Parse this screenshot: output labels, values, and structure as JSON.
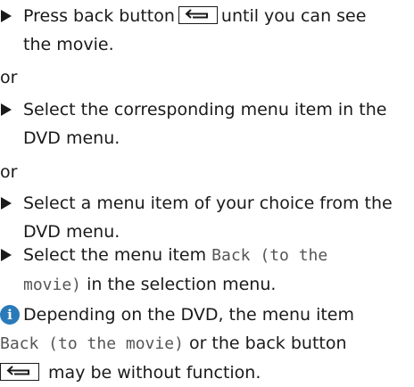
{
  "step1": {
    "before": "Press back button",
    "after": "until you can see",
    "line2": "the movie."
  },
  "or1": "or",
  "step2": {
    "line1": "Select the corresponding menu item in the",
    "line2": "DVD menu."
  },
  "or2": "or",
  "step3": {
    "line1": "Select a menu item of your choice from the",
    "line2": "DVD menu."
  },
  "step4": {
    "before": "Select the menu item",
    "mono1": "Back (to the",
    "mono2": "movie)",
    "after": "in the selection menu."
  },
  "note": {
    "icon": "info-icon",
    "line1": "Depending on the DVD, the menu item",
    "mono": "Back (to the movie)",
    "mid": "or the back button",
    "end": "may be without function."
  },
  "back_key_icon": "back-arrow-icon",
  "colors": {
    "text": "#1a1a1a",
    "mono_text": "#555555",
    "info_icon": "#2a7ab9"
  }
}
